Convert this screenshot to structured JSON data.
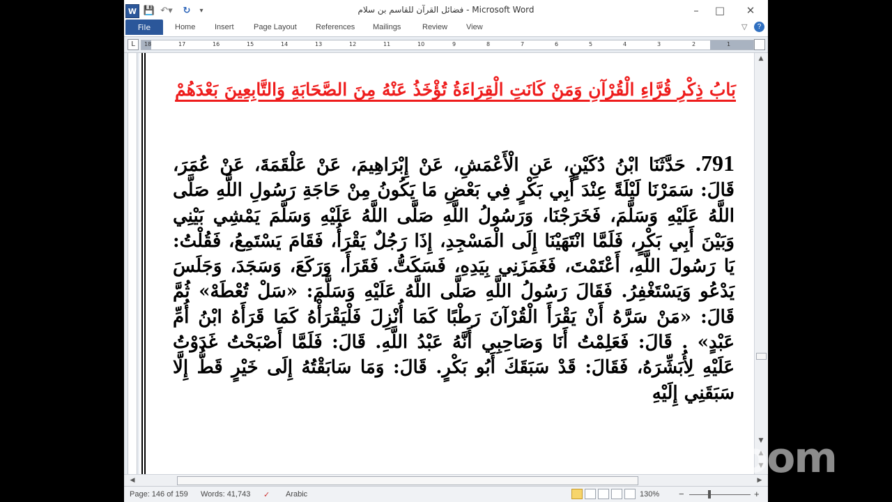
{
  "window": {
    "title": "فضائل القرآن للقاسم بن سلام - Microsoft Word",
    "qat_word_icon": "W"
  },
  "ribbon": {
    "file": "File",
    "tabs": [
      "Home",
      "Insert",
      "Page Layout",
      "References",
      "Mailings",
      "Review",
      "View"
    ]
  },
  "ruler": {
    "numbers": [
      "18",
      "17",
      "16",
      "15",
      "14",
      "13",
      "12",
      "11",
      "10",
      "9",
      "8",
      "7",
      "6",
      "5",
      "4",
      "3",
      "2",
      "1"
    ],
    "corner": "L"
  },
  "document": {
    "heading": "بَابُ ذِكْرِ قُرَّاءِ الْقُرْآنِ وَمَنْ كَانَتِ الْقِرَاءَةُ تُؤْخَذُ عَنْهُ مِنَ الصَّحَابَةِ وَالتَّابِعِينَ بَعْدَهُمْ",
    "hadith_number": "791.",
    "hadith_text": "حَدَّثَنَا ابْنُ دُكَيْنٍ، عَنِ الْأَعْمَشِ، عَنْ إِبْرَاهِيمَ، عَنْ عَلْقَمَةَ، عَنْ عُمَرَ، قَالَ: سَمَرْنَا لَيْلَةً عِنْدَ أَبِي بَكْرٍ فِي بَعْضِ مَا يَكُونُ مِنْ حَاجَةِ رَسُولِ اللَّهِ صَلَّى اللَّهُ عَلَيْهِ وَسَلَّمَ، فَخَرَجْنَا، وَرَسُولُ اللَّهِ صَلَّى اللَّهُ عَلَيْهِ وَسَلَّمَ يَمْشِي بَيْنِي وَبَيْنَ أَبِي بَكْرٍ، فَلَمَّا انْتَهَيْنَا إِلَى الْمَسْجِدِ، إِذَا رَجُلٌ يَقْرَأُ، فَقَامَ يَسْتَمِعُ، فَقُلْتُ: يَا رَسُولَ اللَّهِ، أَعْتَمْتَ، فَغَمَزَنِي بِيَدِهِ، فَسَكَتُّ. فَقَرَأَ، وَرَكَعَ، وَسَجَدَ، وَجَلَسَ يَدْعُو وَيَسْتَغْفِرُ. فَقَالَ رَسُولُ اللَّهِ صَلَّى اللَّهُ عَلَيْهِ وَسَلَّمَ: «سَلْ تُعْطَهْ» ثُمَّ قَالَ: «مَنْ سَرَّهُ أَنْ يَقْرَأَ الْقُرْآنَ رَطْبًا كَمَا أُنْزِلَ فَلْيَقْرَأْهُ كَمَا قَرَأَهُ ابْنُ أُمِّ عَبْدٍ» . قَالَ: فَعَلِمْتُ أَنَا وَصَاحِبِي أَنَّهُ عَبْدُ اللَّهِ. قَالَ: فَلَمَّا أَصْبَحْتُ غَدَوْتُ عَلَيْهِ لِأُبَشِّرَهُ، فَقَالَ: قَدْ سَبَقَكَ أَبُو بَكْرٍ. قَالَ: وَمَا سَابَقْتُهُ إِلَى خَيْرٍ قَطُّ إِلَّا سَبَقَنِي إِلَيْهِ"
  },
  "status": {
    "page": "Page: 146 of 159",
    "words": "Words: 41,743",
    "language": "Arabic",
    "zoom": "130%",
    "zoom_minus": "−",
    "zoom_plus": "+"
  },
  "overlay": {
    "zoom_watermark": "zoom"
  },
  "colors": {
    "file_tab": "#2b579a",
    "heading": "#ee1c1c"
  }
}
